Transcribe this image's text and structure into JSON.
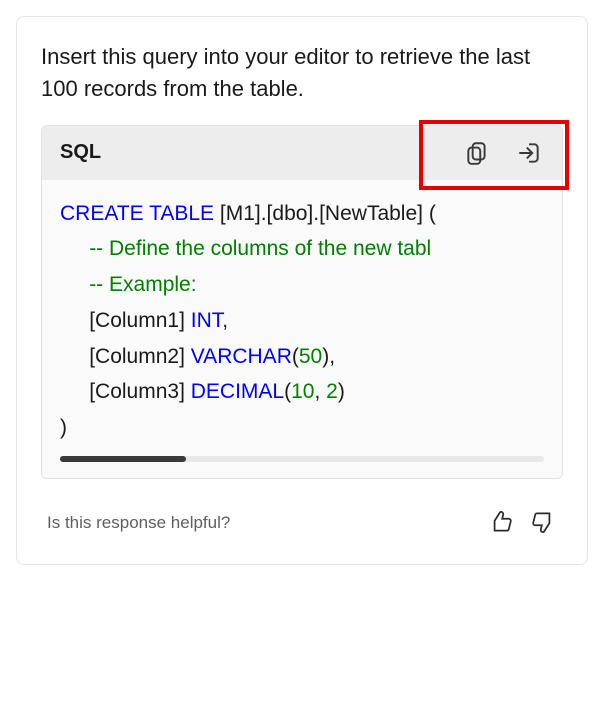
{
  "intro": "Insert this query into your editor to retrieve the last 100 records from the table.",
  "code_block": {
    "language": "SQL",
    "lines": {
      "create_kw": "CREATE TABLE",
      "table_name": " [M1].[dbo].[NewTable] (",
      "comment1_prefix": "-- ",
      "comment1": "Define the columns of the new tabl",
      "comment2_prefix": "-- ",
      "comment2": "Example:",
      "col1_name": "[Column1] ",
      "col1_type": "INT",
      "col1_after": ",",
      "col2_name": "[Column2] ",
      "col2_type": "VARCHAR",
      "col2_lp": "(",
      "col2_size": "50",
      "col2_rp": "),",
      "col3_name": "[Column3] ",
      "col3_type": "DECIMAL",
      "col3_lp": "(",
      "col3_p": "10",
      "col3_comma": ", ",
      "col3_s": "2",
      "col3_rp": ")",
      "close": ")"
    }
  },
  "feedback": {
    "prompt": "Is this response helpful?"
  },
  "highlight": {
    "present": true
  }
}
